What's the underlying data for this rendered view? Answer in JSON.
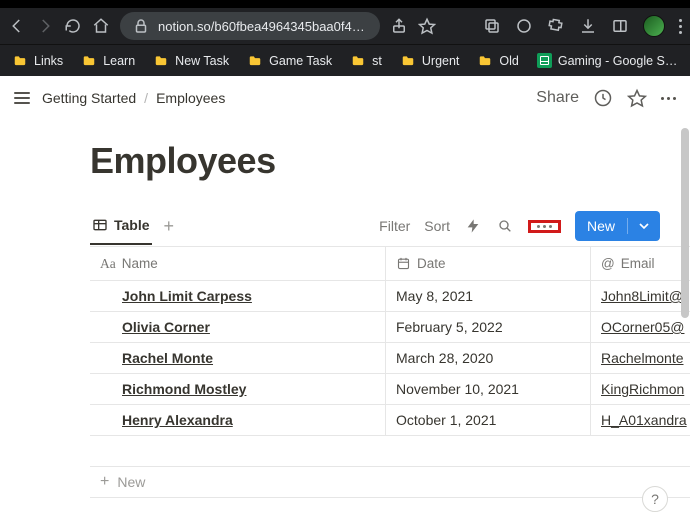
{
  "browser": {
    "url": "notion.so/b60fbea4964345baa0f4e…",
    "bookmarks": [
      {
        "label": "Links"
      },
      {
        "label": "Learn"
      },
      {
        "label": "New Task"
      },
      {
        "label": "Game Task"
      },
      {
        "label": "st"
      },
      {
        "label": "Urgent"
      },
      {
        "label": "Old"
      }
    ],
    "sheets_bookmark": "Gaming - Google S…"
  },
  "notion": {
    "breadcrumb_root": "Getting Started",
    "breadcrumb_page": "Employees",
    "breadcrumb_sep": "/",
    "share_label": "Share",
    "page_title": "Employees"
  },
  "db": {
    "view_label": "Table",
    "filter_label": "Filter",
    "sort_label": "Sort",
    "new_button": "New",
    "columns": {
      "name": "Name",
      "date": "Date",
      "email": "Email"
    },
    "rows": [
      {
        "name": "John Limit Carpess",
        "date": "May 8, 2021",
        "email": "John8Limit@"
      },
      {
        "name": "Olivia Corner",
        "date": "February 5, 2022",
        "email": "OCorner05@"
      },
      {
        "name": "Rachel Monte",
        "date": "March 28, 2020",
        "email": "Rachelmonte"
      },
      {
        "name": "Richmond Mostley",
        "date": "November 10, 2021",
        "email": "KingRichmon"
      },
      {
        "name": "Henry Alexandra",
        "date": "October 1, 2021",
        "email": "H_A01xandra"
      }
    ],
    "new_row_label": "New"
  },
  "help_label": "?"
}
